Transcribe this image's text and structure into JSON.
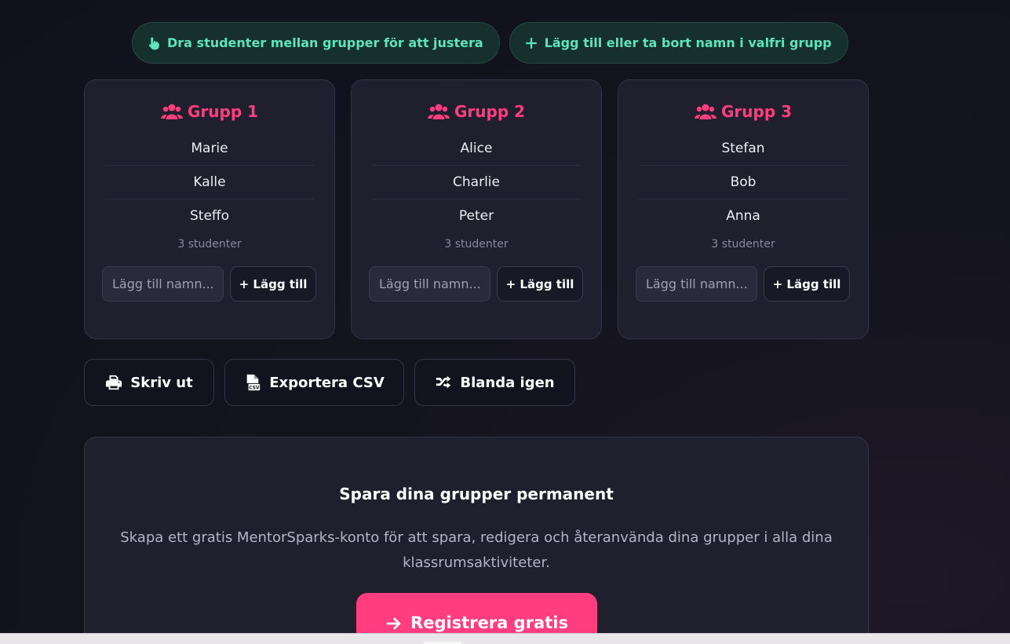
{
  "hints": [
    {
      "icon": "hand-pointer-icon",
      "label": "Dra studenter mellan grupper för att justera"
    },
    {
      "icon": "plus-icon",
      "label": "Lägg till eller ta bort namn i valfri grupp"
    }
  ],
  "groups": [
    {
      "title": "Grupp 1",
      "members": [
        "Marie",
        "Kalle",
        "Steffo"
      ],
      "count": "3 studenter",
      "input_placeholder": "Lägg till namn...",
      "add_label": "+ Lägg till"
    },
    {
      "title": "Grupp 2",
      "members": [
        "Alice",
        "Charlie",
        "Peter"
      ],
      "count": "3 studenter",
      "input_placeholder": "Lägg till namn...",
      "add_label": "+ Lägg till"
    },
    {
      "title": "Grupp 3",
      "members": [
        "Stefan",
        "Bob",
        "Anna"
      ],
      "count": "3 studenter",
      "input_placeholder": "Lägg till namn...",
      "add_label": "+ Lägg till"
    }
  ],
  "actions": {
    "print_label": "Skriv ut",
    "export_label": "Exportera CSV",
    "shuffle_label": "Blanda igen"
  },
  "promo": {
    "title": "Spara dina grupper permanent",
    "text": "Skapa ett gratis MentorSparks-konto för att spara, redigera och återanvända dina grupper i alla dina klassrumsaktiviteter.",
    "register_label": "Registrera gratis"
  },
  "colors": {
    "accent": "#ff3d7f",
    "hint_text": "#5fe3b8",
    "background": "#12121f",
    "card": "#1f1f2e"
  }
}
